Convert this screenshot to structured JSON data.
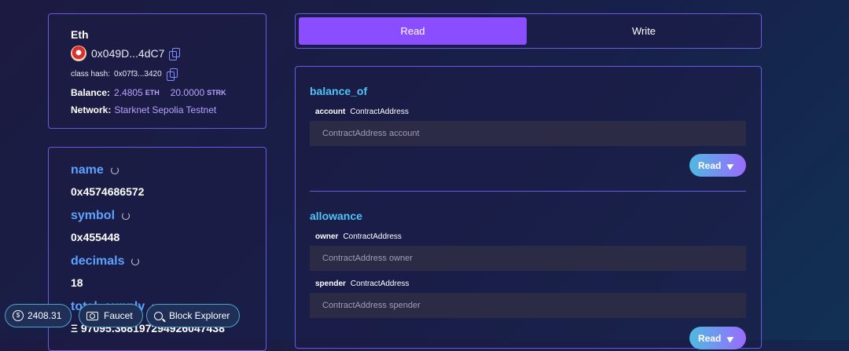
{
  "contract": {
    "name": "Eth",
    "address": "0x049D...4dC7",
    "class_hash_label": "class hash:",
    "class_hash": "0x07f3...3420",
    "balance_label": "Balance:",
    "balance_eth": "2.4805",
    "eth_unit": "ETH",
    "balance_strk": "20.0000",
    "strk_unit": "STRK",
    "network_label": "Network:",
    "network": "Starknet Sepolia Testnet"
  },
  "variables": [
    {
      "name": "name",
      "value": "0x4574686572"
    },
    {
      "name": "symbol",
      "value": "0x455448"
    },
    {
      "name": "decimals",
      "value": "18"
    },
    {
      "name": "total_supply",
      "value": "Ξ 97095.368197294926047438"
    }
  ],
  "tabs": {
    "read": "Read",
    "write": "Write",
    "active": "Read"
  },
  "functions": [
    {
      "name": "balance_of",
      "params": [
        {
          "name": "account",
          "type": "ContractAddress",
          "placeholder": "ContractAddress account"
        }
      ],
      "button": "Read"
    },
    {
      "name": "allowance",
      "params": [
        {
          "name": "owner",
          "type": "ContractAddress",
          "placeholder": "ContractAddress owner"
        },
        {
          "name": "spender",
          "type": "ContractAddress",
          "placeholder": "ContractAddress spender"
        }
      ],
      "button": "Read"
    }
  ],
  "footer": {
    "price": "2408.31",
    "faucet": "Faucet",
    "block_explorer": "Block Explorer"
  },
  "colors": {
    "accent_purple": "#8a4dff",
    "link_blue": "#5aa3ff",
    "function_cyan": "#4fc3f7",
    "border": "#6a5ae0"
  },
  "icons": [
    "copy-icon",
    "avatar",
    "refresh-icon",
    "send-icon",
    "dollar-icon",
    "faucet-icon",
    "search-icon"
  ]
}
